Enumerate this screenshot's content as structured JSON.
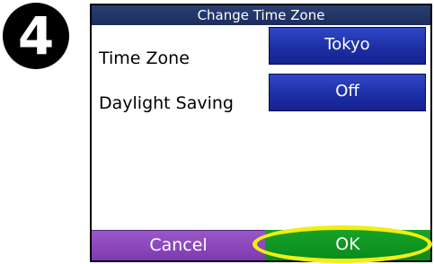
{
  "step": {
    "number": "4"
  },
  "dialog": {
    "title": "Change Time Zone",
    "fields": [
      {
        "label": "Time Zone",
        "value": "Tokyo"
      },
      {
        "label": "Daylight Saving",
        "value": "Off"
      }
    ]
  },
  "buttons": {
    "cancel": "Cancel",
    "ok": "OK"
  },
  "colors": {
    "title_bar": "#1c2d5c",
    "value_button": "#1c2fa4",
    "cancel_button": "#8a46b8",
    "ok_button": "#0f9622",
    "highlight": "#f2ee14"
  }
}
